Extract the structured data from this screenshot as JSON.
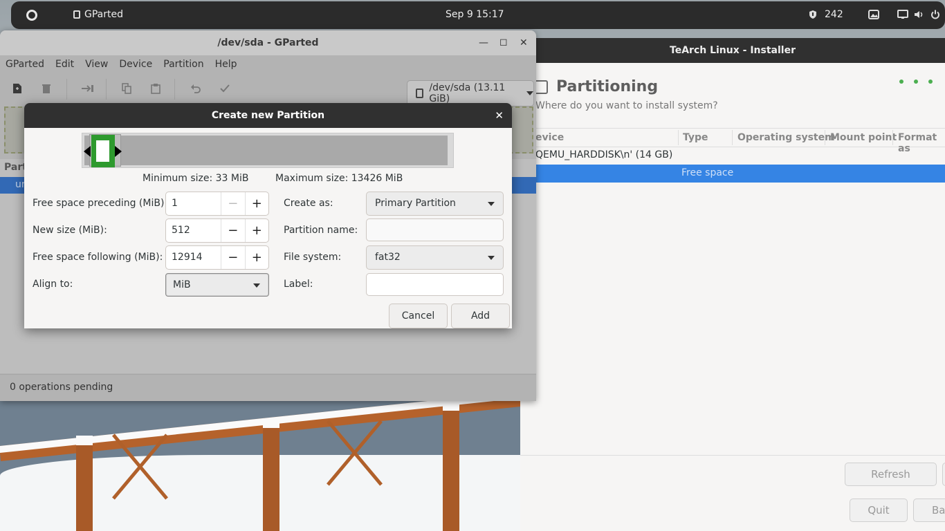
{
  "topbar": {
    "app_name": "GParted",
    "clock": "Sep 9  15:17",
    "tray_count": "242",
    "icons": [
      "activities-icon",
      "shield-icon",
      "image-icon",
      "display-icon",
      "volume-icon",
      "power-icon"
    ]
  },
  "installer": {
    "title": "TeArch Linux - Installer",
    "heading": "Partitioning",
    "subheading": "Where do you want to install system?",
    "columns": [
      "evice",
      "Type",
      "Operating system",
      "Mount point",
      "Format as"
    ],
    "rows": [
      {
        "device": "QEMU_HARDDISK\\n' (14 GB)"
      },
      {
        "type": "Free space",
        "selected": true
      }
    ],
    "refresh_label": "Refresh",
    "quit_label": "Quit",
    "back_label": "Bac"
  },
  "gparted": {
    "title": "/dev/sda - GParted",
    "menu": [
      "GParted",
      "Edit",
      "View",
      "Device",
      "Partition",
      "Help"
    ],
    "device_selector": "/dev/sda (13.11 GiB)",
    "partition_header": "Part",
    "selected_row": "ur",
    "status": "0 operations pending"
  },
  "dialog": {
    "title": "Create new Partition",
    "min_size": "Minimum size: 33 MiB",
    "max_size": "Maximum size: 13426 MiB",
    "labels": {
      "preceding": "Free space preceding (MiB):",
      "new_size": "New size (MiB):",
      "following": "Free space following (MiB):",
      "align": "Align to:",
      "create_as": "Create as:",
      "partition_name": "Partition name:",
      "file_system": "File system:",
      "label": "Label:"
    },
    "values": {
      "preceding": "1",
      "new_size": "512",
      "following": "12914",
      "align": "MiB",
      "create_as": "Primary Partition",
      "partition_name": "",
      "file_system": "fat32",
      "label": ""
    },
    "cancel_label": "Cancel",
    "add_label": "Add",
    "minus": "−",
    "plus": "+"
  }
}
